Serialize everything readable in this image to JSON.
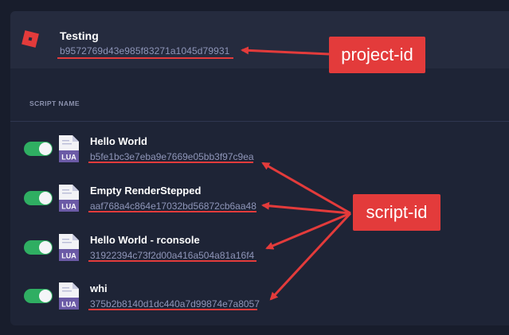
{
  "project": {
    "name": "Testing",
    "id": "b9572769d43e985f83271a1045d79931"
  },
  "table": {
    "column_header": "SCRIPT NAME"
  },
  "file_badge": "LUA",
  "scripts": [
    {
      "name": "Hello World",
      "id": "b5fe1bc3e7eba9e7669e05bb3f97c9ea",
      "enabled": true
    },
    {
      "name": "Empty RenderStepped",
      "id": "aaf768a4c864e17032bd56872cb6aa48",
      "enabled": true
    },
    {
      "name": "Hello World - rconsole",
      "id": "31922394c73f2d00a416a504a81a16f4",
      "enabled": true
    },
    {
      "name": "whi",
      "id": "375b2b8140d1dc440a7d99874e7a8057",
      "enabled": true
    }
  ],
  "annotations": {
    "project_label": "project-id",
    "script_label": "script-id"
  },
  "colors": {
    "background": "#181d2c",
    "panel": "#1e2436",
    "toggle_on": "#2fae62",
    "annotation": "#e33b3b",
    "file_icon": "#6b5aa6"
  },
  "icons": {
    "logo": "roblox-logo-icon",
    "file": "lua-file-icon"
  }
}
